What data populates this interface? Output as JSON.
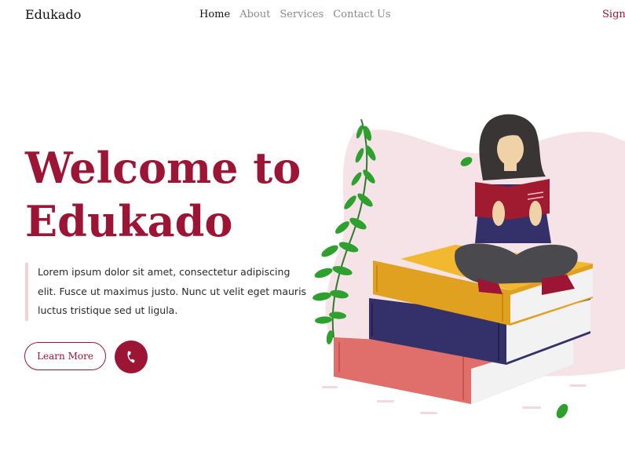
{
  "nav": {
    "brand": "Edukado",
    "links": [
      {
        "label": "Home"
      },
      {
        "label": "About"
      },
      {
        "label": "Services"
      },
      {
        "label": "Contact Us"
      }
    ],
    "signin": "Sign In"
  },
  "hero": {
    "title_line1": "Welcome to",
    "title_line2": "Edukado",
    "description": "Lorem ipsum dolor sit amet, consectetur adipiscing elit. Fusce ut maximus justo. Nunc ut velit eget mauris luctus tristique sed ut ligula.",
    "learn_more": "Learn More",
    "phone_icon": "phone-icon"
  },
  "colors": {
    "accent": "#9c1535",
    "blob": "#f6e3e8",
    "leaf": "#2ea02e",
    "book_yellow": "#e0a020",
    "book_navy": "#34306a",
    "book_red": "#e06e6a"
  }
}
